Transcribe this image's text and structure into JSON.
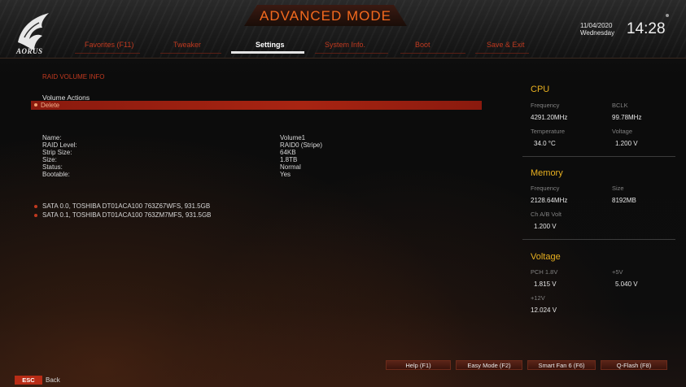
{
  "header": {
    "brand": "AORUS",
    "mode": "ADVANCED MODE",
    "date": "11/04/2020",
    "weekday": "Wednesday",
    "time": "14:28",
    "accent": "#f46a1e",
    "tabs": [
      {
        "label": "Favorites (F11)"
      },
      {
        "label": "Tweaker"
      },
      {
        "label": "Settings"
      },
      {
        "label": "System Info."
      },
      {
        "label": "Boot"
      },
      {
        "label": "Save & Exit"
      }
    ],
    "active_tab": "Settings"
  },
  "main": {
    "section_title": "RAID VOLUME INFO",
    "actions_label": "Volume Actions",
    "delete_label": "Delete",
    "info": [
      {
        "key": "Name:",
        "value": "Volume1"
      },
      {
        "key": "RAID Level:",
        "value": "RAID0 (Stripe)"
      },
      {
        "key": "Strip Size:",
        "value": "64KB"
      },
      {
        "key": "Size:",
        "value": "1.8TB"
      },
      {
        "key": "Status:",
        "value": "Normal"
      },
      {
        "key": "Bootable:",
        "value": "Yes"
      }
    ],
    "disks": [
      "SATA 0.0, TOSHIBA DT01ACA100 763Z67WFS, 931.5GB",
      "SATA 0.1, TOSHIBA DT01ACA100 763ZM7MFS, 931.5GB"
    ]
  },
  "monitor": {
    "cpu": {
      "title": "CPU",
      "freq_label": "Frequency",
      "freq": "4291.20MHz",
      "bclk_label": "BCLK",
      "bclk": "99.78MHz",
      "temp_label": "Temperature",
      "temp": "34.0 °C",
      "volt_label": "Voltage",
      "volt": "1.200 V"
    },
    "memory": {
      "title": "Memory",
      "freq_label": "Frequency",
      "freq": "2128.64MHz",
      "size_label": "Size",
      "size": "8192MB",
      "chab_label": "Ch A/B Volt",
      "chab": "1.200 V"
    },
    "voltage": {
      "title": "Voltage",
      "pch_label": "PCH 1.8V",
      "pch": "1.815 V",
      "p5_label": "+5V",
      "p5": "5.040 V",
      "p12_label": "+12V",
      "p12": "12.024 V"
    },
    "title_color": "#e8b020"
  },
  "footer": {
    "buttons": [
      {
        "label": "Help (F1)"
      },
      {
        "label": "Easy Mode (F2)"
      },
      {
        "label": "Smart Fan 6 (F6)"
      },
      {
        "label": "Q-Flash (F8)"
      }
    ],
    "esc_label": "ESC",
    "back_label": "Back"
  }
}
